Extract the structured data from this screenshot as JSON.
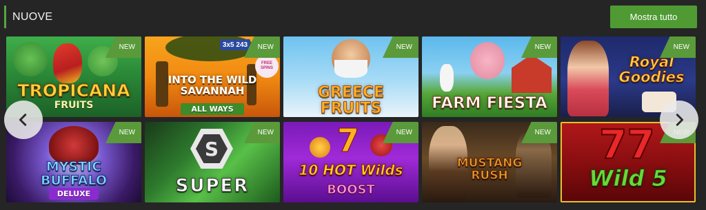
{
  "section": {
    "title": "NUOVE",
    "show_all_label": "Mostra tutto"
  },
  "colors": {
    "accent": "#5aa63c",
    "badge": "#5a9a3a"
  },
  "games": [
    {
      "title": "TROPICANA",
      "subtitle": "FRUITS",
      "badge": "NEW"
    },
    {
      "title": "INTO THE WILD SAVANNAH",
      "subtitle": "ALL WAYS",
      "extra": "3x5 243",
      "extra2": "FREE SPINS",
      "badge": "NEW"
    },
    {
      "title": "GREECE FRUITS",
      "badge": "NEW"
    },
    {
      "title": "FARM FIESTA",
      "badge": "NEW"
    },
    {
      "title": "Royal Goodies",
      "badge": "NEW"
    },
    {
      "title": "MYSTIC BUFFALO",
      "subtitle": "DELUXE",
      "badge": "NEW"
    },
    {
      "title": "SUPER",
      "badge": "NEW"
    },
    {
      "title": "10 HOT Wilds",
      "subtitle": "BOOST",
      "badge": "NEW"
    },
    {
      "title": "MUSTANG RUSH",
      "badge": "NEW"
    },
    {
      "title": "Wild 5",
      "badge": "NEW"
    }
  ],
  "nav": {
    "prev_icon": "chevron-left-icon",
    "next_icon": "chevron-right-icon"
  }
}
